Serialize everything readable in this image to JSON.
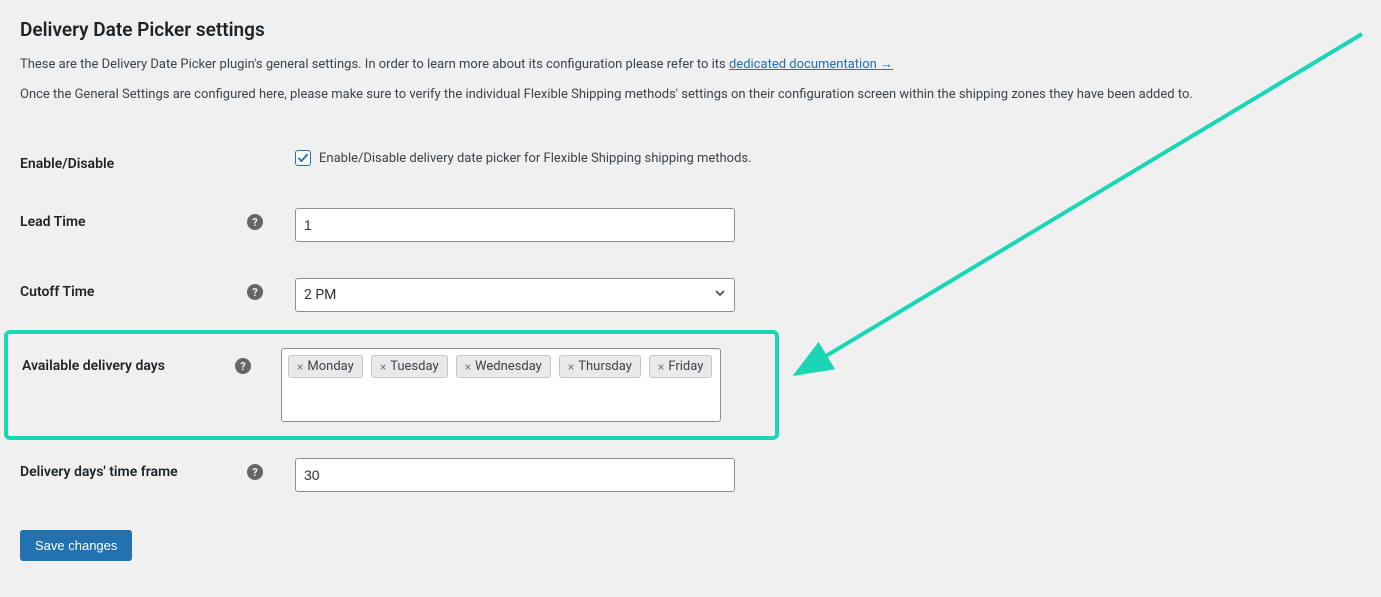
{
  "heading": "Delivery Date Picker settings",
  "intro1_prefix": "These are the Delivery Date Picker plugin's general settings. In order to learn more about its configuration please refer to its ",
  "intro1_link": "dedicated documentation →",
  "intro2": "Once the General Settings are configured here, please make sure to verify the individual Flexible Shipping methods' settings on their configuration screen within the shipping zones they have been added to.",
  "fields": {
    "enable": {
      "label": "Enable/Disable",
      "checkbox_label": "Enable/Disable delivery date picker for Flexible Shipping shipping methods."
    },
    "lead_time": {
      "label": "Lead Time",
      "value": "1"
    },
    "cutoff": {
      "label": "Cutoff Time",
      "value": "2 PM"
    },
    "available_days": {
      "label": "Available delivery days",
      "tags": [
        "Monday",
        "Tuesday",
        "Wednesday",
        "Thursday",
        "Friday"
      ]
    },
    "time_frame": {
      "label": "Delivery days' time frame",
      "value": "30"
    }
  },
  "save_button": "Save changes"
}
